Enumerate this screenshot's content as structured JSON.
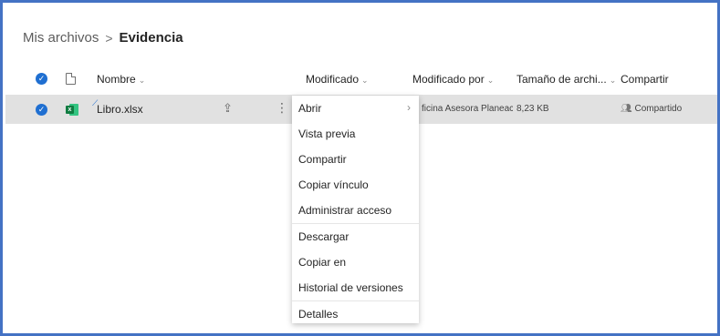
{
  "breadcrumb": {
    "root": "Mis archivos",
    "separator": ">",
    "current": "Evidencia"
  },
  "columns": {
    "name": "Nombre",
    "modified": "Modificado",
    "modified_by": "Modificado por",
    "file_size": "Tamaño de archi...",
    "sharing": "Compartir"
  },
  "file": {
    "name": "Libro.xlsx",
    "modified_by": "ficina Asesora Planeacion",
    "size": "8,23 KB",
    "sharing": "Compartido"
  },
  "context_menu": {
    "items": [
      {
        "label": "Abrir",
        "has_submenu": true
      },
      {
        "label": "Vista previa"
      },
      {
        "label": "Compartir"
      },
      {
        "label": "Copiar vínculo"
      },
      {
        "label": "Administrar acceso"
      },
      {
        "label": "Descargar"
      },
      {
        "label": "Copiar en"
      },
      {
        "label": "Historial de versiones"
      },
      {
        "label": "Detalles"
      }
    ]
  },
  "colors": {
    "frame_border": "#4472c4",
    "accent_blue": "#1f6fd1",
    "selected_row": "#e1e1e1",
    "excel_green": "#107c41"
  },
  "icons": {
    "select_all": "checkmark-circle-icon",
    "file_type_header": "document-icon",
    "row_checked": "checkmark-circle-icon",
    "excel": "excel-file-icon",
    "share": "share-icon",
    "more": "more-options-icon",
    "shared_people": "people-icon"
  }
}
